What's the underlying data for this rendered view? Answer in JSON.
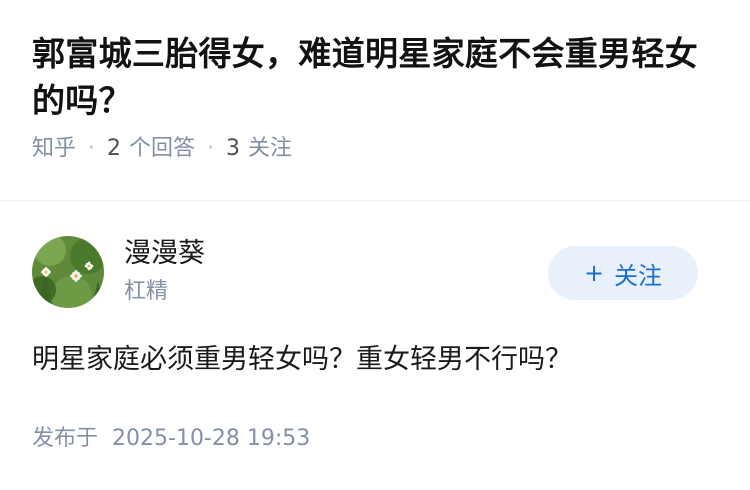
{
  "question": {
    "title": "郭富城三胎得女，难道明星家庭不会重男轻女的吗？",
    "source": "知乎",
    "separator": "·",
    "answer_count": "2",
    "answer_label": "个回答",
    "follow_count": "3",
    "follow_label": "关注"
  },
  "author": {
    "name": "漫漫葵",
    "badge": "杠精",
    "avatar_icon": "avatar-image"
  },
  "follow_button": {
    "icon": "+",
    "label": "关注"
  },
  "answer": {
    "text": "明星家庭必须重男轻女吗？重女轻男不行吗？"
  },
  "publish": {
    "label": "发布于",
    "datetime": "2025-10-28 19:53"
  },
  "colors": {
    "text_primary": "#121212",
    "text_secondary": "#8590a6",
    "accent": "#1a6ecf",
    "button_bg": "#e8f1fb"
  }
}
